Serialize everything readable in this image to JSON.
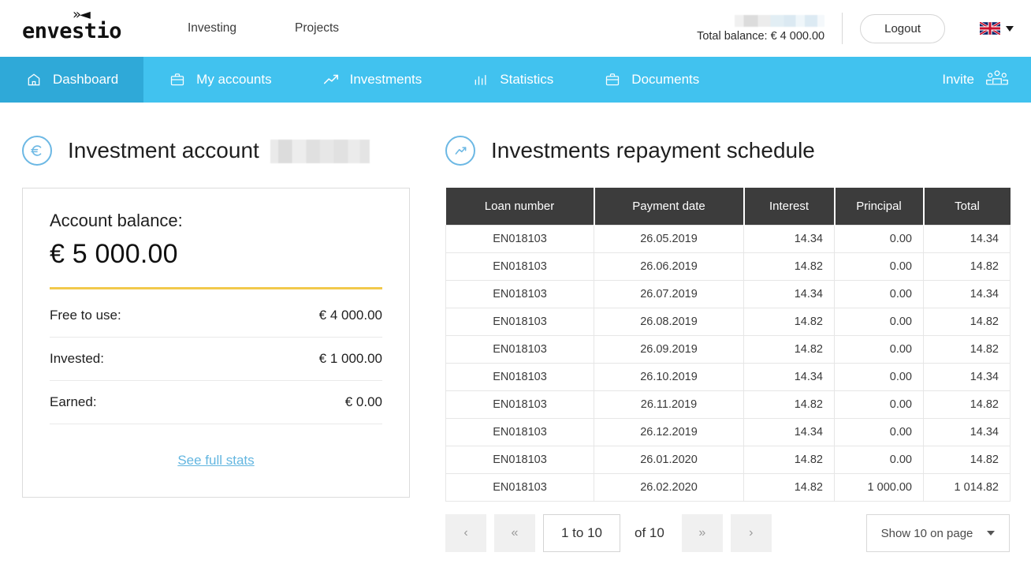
{
  "brand": {
    "logo_text": "envestio",
    "logo_mark": "»◄"
  },
  "header": {
    "nav": [
      {
        "label": "Investing"
      },
      {
        "label": "Projects"
      }
    ],
    "total_balance": "Total balance: € 4 000.00",
    "logout_label": "Logout",
    "language_icon": "uk-flag-icon",
    "redacted_label": ""
  },
  "mainnav": {
    "items": [
      {
        "label": "Dashboard",
        "icon": "home-icon",
        "active": true
      },
      {
        "label": "My accounts",
        "icon": "briefcase-icon",
        "active": false
      },
      {
        "label": "Investments",
        "icon": "trending-up-icon",
        "active": false
      },
      {
        "label": "Statistics",
        "icon": "bar-chart-icon",
        "active": false
      },
      {
        "label": "Documents",
        "icon": "portfolio-icon",
        "active": false
      }
    ],
    "invite_label": "Invite",
    "invite_icon": "people-group-icon",
    "bg_color": "#41c2ef",
    "active_color": "#2fa9d8"
  },
  "account_panel": {
    "title": "Investment account",
    "title_icon": "euro-circle-icon",
    "balance_label": "Account balance:",
    "balance_value": "€ 5 000.00",
    "accent_color": "#f2c94c",
    "rows": [
      {
        "label": "Free to use:",
        "value": "€ 4 000.00"
      },
      {
        "label": "Invested:",
        "value": "€ 1 000.00"
      },
      {
        "label": "Earned:",
        "value": "€ 0.00"
      }
    ],
    "full_stats_link": "See full stats",
    "link_color": "#63b6e0"
  },
  "schedule_panel": {
    "title": "Investments repayment schedule",
    "title_icon": "trending-circle-icon",
    "columns": [
      "Loan number",
      "Payment date",
      "Interest",
      "Principal",
      "Total"
    ],
    "rows": [
      {
        "loan": "EN018103",
        "date": "26.05.2019",
        "interest": "14.34",
        "principal": "0.00",
        "total": "14.34"
      },
      {
        "loan": "EN018103",
        "date": "26.06.2019",
        "interest": "14.82",
        "principal": "0.00",
        "total": "14.82"
      },
      {
        "loan": "EN018103",
        "date": "26.07.2019",
        "interest": "14.34",
        "principal": "0.00",
        "total": "14.34"
      },
      {
        "loan": "EN018103",
        "date": "26.08.2019",
        "interest": "14.82",
        "principal": "0.00",
        "total": "14.82"
      },
      {
        "loan": "EN018103",
        "date": "26.09.2019",
        "interest": "14.82",
        "principal": "0.00",
        "total": "14.82"
      },
      {
        "loan": "EN018103",
        "date": "26.10.2019",
        "interest": "14.34",
        "principal": "0.00",
        "total": "14.34"
      },
      {
        "loan": "EN018103",
        "date": "26.11.2019",
        "interest": "14.82",
        "principal": "0.00",
        "total": "14.82"
      },
      {
        "loan": "EN018103",
        "date": "26.12.2019",
        "interest": "14.34",
        "principal": "0.00",
        "total": "14.34"
      },
      {
        "loan": "EN018103",
        "date": "26.01.2020",
        "interest": "14.82",
        "principal": "0.00",
        "total": "14.82"
      },
      {
        "loan": "EN018103",
        "date": "26.02.2020",
        "interest": "14.82",
        "principal": "1 000.00",
        "total": "1 014.82"
      }
    ],
    "header_bg": "#3c3c3c"
  },
  "pagination": {
    "prev_label": "‹",
    "first_label": "«",
    "range_label": "1 to 10",
    "of_label": "of 10",
    "last_label": "»",
    "next_label": "›",
    "page_size_label": "Show 10 on page"
  }
}
